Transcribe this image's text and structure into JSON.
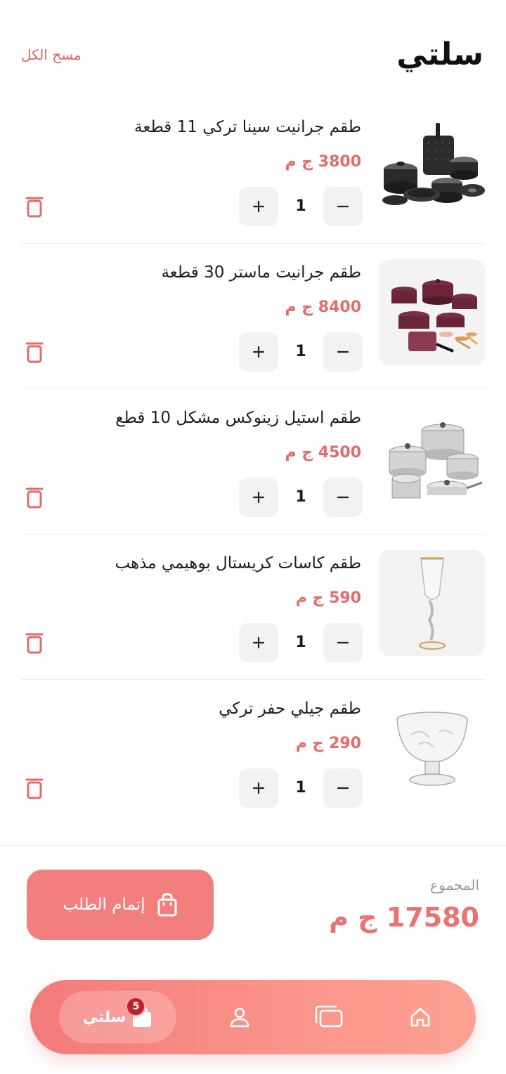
{
  "header": {
    "title": "سلتي",
    "clear_all": "مسح الكل"
  },
  "items": [
    {
      "name": "طقم جرانيت سينا تركي 11 قطعة",
      "price": "3800 ج م",
      "qty": "1",
      "image": "granite-cookware-set-black"
    },
    {
      "name": "طقم جرانيت ماستر 30 قطعة",
      "price": "8400 ج م",
      "qty": "1",
      "image": "granite-cookware-set-burgundy"
    },
    {
      "name": "طقم استيل زينوكس مشكل 10 قطع",
      "price": "4500 ج م",
      "qty": "1",
      "image": "stainless-steel-pots"
    },
    {
      "name": "طقم كاسات كريستال بوهيمي مذهب",
      "price": "590 ج م",
      "qty": "1",
      "image": "crystal-champagne-glass"
    },
    {
      "name": "طقم جيلي حفر تركي",
      "price": "290 ج م",
      "qty": "1",
      "image": "etched-glass-dessert-bowl"
    }
  ],
  "summary": {
    "total_label": "المجموع",
    "total_value": "17580 ج م",
    "checkout_label": "إتمام الطلب"
  },
  "bottom_nav": {
    "cart_label": "سلتي",
    "cart_badge": "5",
    "icons": [
      "home-icon",
      "catalog-icon",
      "profile-icon",
      "shopping-bag-icon"
    ]
  },
  "colors": {
    "accent": "#f27f7d",
    "price": "#e46b6b",
    "badge": "#c21f2c"
  }
}
